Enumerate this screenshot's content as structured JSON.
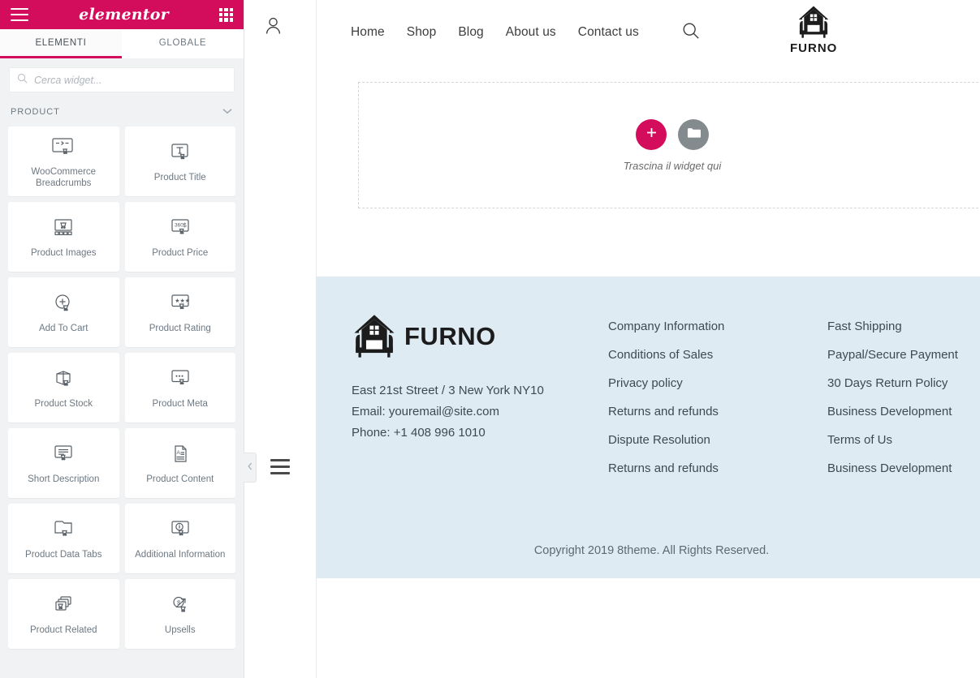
{
  "panel": {
    "brand": "elementor",
    "menu_icon": "hamburger-icon",
    "grid_icon": "apps-grid-icon",
    "tabs": [
      {
        "label": "ELEMENTI",
        "active": true
      },
      {
        "label": "GLOBALE",
        "active": false
      }
    ],
    "search": {
      "placeholder": "Cerca widget...",
      "value": "",
      "icon": "search-icon"
    },
    "category": {
      "label": "PRODUCT",
      "collapse_icon": "chevron-down-icon"
    },
    "widgets": [
      {
        "label": "WooCommerce Breadcrumbs",
        "icon": "breadcrumbs-widget-icon"
      },
      {
        "label": "Product Title",
        "icon": "text-widget-icon"
      },
      {
        "label": "Product Images",
        "icon": "images-widget-icon"
      },
      {
        "label": "Product Price",
        "icon": "price-widget-icon"
      },
      {
        "label": "Add To Cart",
        "icon": "add-to-cart-widget-icon"
      },
      {
        "label": "Product Rating",
        "icon": "rating-widget-icon"
      },
      {
        "label": "Product Stock",
        "icon": "stock-widget-icon"
      },
      {
        "label": "Product Meta",
        "icon": "meta-widget-icon"
      },
      {
        "label": "Short Description",
        "icon": "short-description-widget-icon"
      },
      {
        "label": "Product Content",
        "icon": "content-widget-icon"
      },
      {
        "label": "Product Data Tabs",
        "icon": "data-tabs-widget-icon"
      },
      {
        "label": "Additional Information",
        "icon": "info-widget-icon"
      },
      {
        "label": "Product Related",
        "icon": "related-widget-icon"
      },
      {
        "label": "Upsells",
        "icon": "upsells-widget-icon"
      }
    ],
    "collapse_handle": {
      "icon": "chevron-left-icon"
    }
  },
  "preview": {
    "account_icon": "user-icon",
    "structure_icon": "hamburger-icon",
    "nav": [
      {
        "label": "Home"
      },
      {
        "label": "Shop"
      },
      {
        "label": "Blog"
      },
      {
        "label": "About us"
      },
      {
        "label": "Contact us"
      }
    ],
    "nav_search_icon": "search-icon",
    "logo": {
      "name": "FURNO",
      "icon": "furno-house-chair-logo"
    },
    "dropzone": {
      "add_icon": "plus-icon",
      "folder_icon": "folder-icon",
      "caption": "Trascina il widget qui"
    },
    "footer": {
      "logo_name": "FURNO",
      "address": "East 21st Street / 3 New York NY10",
      "email": "Email: youremail@site.com",
      "phone": "Phone: +1 408 996 1010",
      "links_col1": [
        "Company Information",
        "Conditions of Sales",
        "Privacy policy",
        "Returns and refunds",
        "Dispute Resolution",
        "Returns and refunds"
      ],
      "links_col2": [
        "Fast Shipping",
        "Paypal/Secure Payment",
        "30 Days Return Policy",
        "Business Development",
        "Terms of Us",
        "Business Development"
      ],
      "copyright": "Copyright 2019 8theme. All Rights Reserved."
    }
  },
  "colors": {
    "elementor_pink": "#d30c5c",
    "panel_bg": "#f1f2f3",
    "footer_bg": "#deebf2",
    "folder_gray": "#838b8f"
  }
}
